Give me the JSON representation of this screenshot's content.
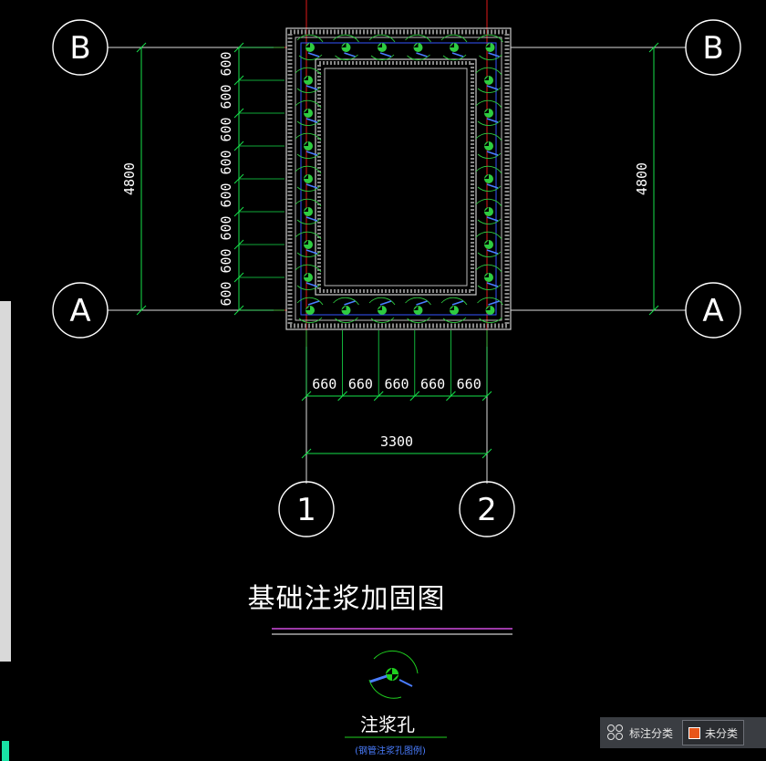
{
  "drawing": {
    "grid_axes": {
      "row_top": "B",
      "row_bottom": "A",
      "col_left": "1",
      "col_right": "2"
    },
    "dims": {
      "vertical_total": "4800",
      "vertical_spacing": [
        "600",
        "600",
        "600",
        "600",
        "600",
        "600",
        "600",
        "600"
      ],
      "horizontal_spacing": [
        "660",
        "660",
        "660",
        "660",
        "660"
      ],
      "horizontal_total": "3300"
    },
    "title": "基础注浆加固图",
    "legend_title": "注浆孔",
    "legend_sub": "(钢管注浆孔图例)"
  },
  "statusbar": {
    "classify_label": "标注分类",
    "uncategorized_label": "未分类",
    "uncategorized_color": "#e8561a"
  },
  "colors": {
    "grid_line": "#e01818",
    "dim_line": "#16e04a",
    "rebar": "#2ecc40",
    "title_underline": "#d04ce0",
    "legend_underline": "#1fd01f"
  }
}
